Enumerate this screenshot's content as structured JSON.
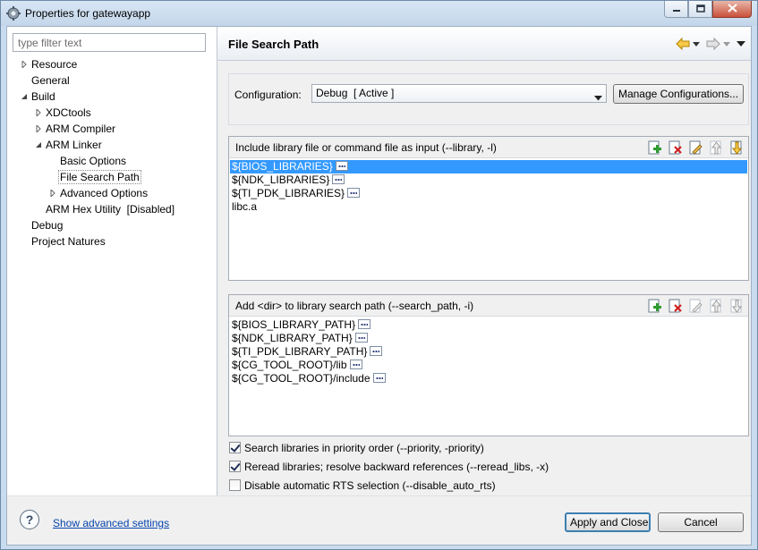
{
  "window": {
    "title": "Properties for gatewayapp"
  },
  "filter": {
    "placeholder": "type filter text"
  },
  "tree": {
    "items": [
      {
        "label": "Resource"
      },
      {
        "label": "General"
      },
      {
        "label": "Build"
      },
      {
        "label": "XDCtools"
      },
      {
        "label": "ARM Compiler"
      },
      {
        "label": "ARM Linker"
      },
      {
        "label": "Basic Options"
      },
      {
        "label": "File Search Path"
      },
      {
        "label": "Advanced Options"
      },
      {
        "label": "ARM Hex Utility  [Disabled]"
      },
      {
        "label": "Debug"
      },
      {
        "label": "Project Natures"
      }
    ]
  },
  "page": {
    "title": "File Search Path"
  },
  "configuration": {
    "label": "Configuration:",
    "selected": "Debug  [ Active ]",
    "manage_label": "Manage Configurations..."
  },
  "include_list": {
    "title": "Include library file or command file as input (--library, -l)",
    "items": [
      {
        "text": "${BIOS_LIBRARIES}"
      },
      {
        "text": "${NDK_LIBRARIES}"
      },
      {
        "text": "${TI_PDK_LIBRARIES}"
      },
      {
        "text": "libc.a"
      }
    ]
  },
  "search_list": {
    "title": "Add <dir> to library search path (--search_path, -i)",
    "items": [
      {
        "text": "${BIOS_LIBRARY_PATH}"
      },
      {
        "text": "${NDK_LIBRARY_PATH}"
      },
      {
        "text": "${TI_PDK_LIBRARY_PATH}"
      },
      {
        "text": "${CG_TOOL_ROOT}/lib"
      },
      {
        "text": "${CG_TOOL_ROOT}/include"
      }
    ]
  },
  "options": {
    "priority": {
      "label": "Search libraries in priority order (--priority, -priority)",
      "checked": true
    },
    "reread": {
      "label": "Reread libraries; resolve backward references (--reread_libs, -x)",
      "checked": true
    },
    "disable_rts": {
      "label": "Disable automatic RTS selection (--disable_auto_rts)",
      "checked": false
    }
  },
  "footer": {
    "help_symbol": "?",
    "advanced_link": "Show advanced settings",
    "apply_label": "Apply and Close",
    "cancel_label": "Cancel"
  },
  "colors": {
    "selection": "#3399ff",
    "link": "#0645ad"
  }
}
